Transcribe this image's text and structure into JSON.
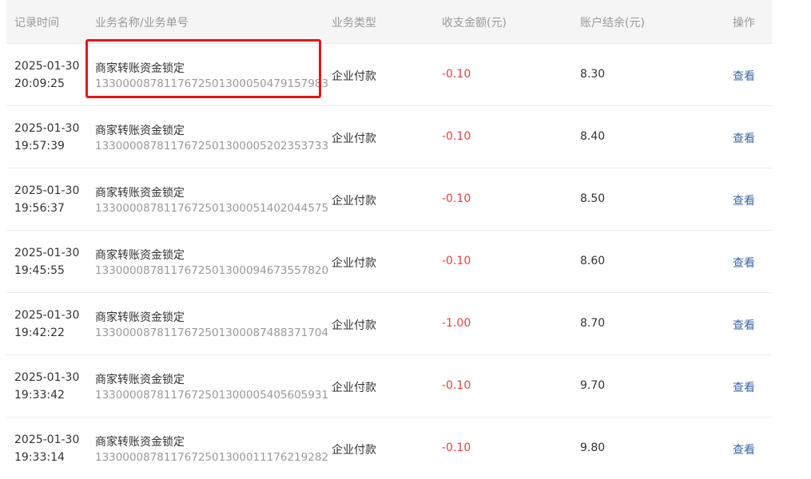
{
  "headers": {
    "time": "记录时间",
    "name": "业务名称/业务单号",
    "type": "业务类型",
    "amount": "收支金额(元)",
    "balance": "账户结余(元)",
    "action": "操作"
  },
  "rows": [
    {
      "date": "2025-01-30",
      "time": "20:09:25",
      "name": "商家转账资金锁定",
      "order": "1330000878117672501300050479157983",
      "type": "企业付款",
      "amount": "-0.10",
      "balance": "8.30",
      "action": "查看"
    },
    {
      "date": "2025-01-30",
      "time": "19:57:39",
      "name": "商家转账资金锁定",
      "order": "1330000878117672501300005202353733",
      "type": "企业付款",
      "amount": "-0.10",
      "balance": "8.40",
      "action": "查看"
    },
    {
      "date": "2025-01-30",
      "time": "19:56:37",
      "name": "商家转账资金锁定",
      "order": "1330000878117672501300051402044575",
      "type": "企业付款",
      "amount": "-0.10",
      "balance": "8.50",
      "action": "查看"
    },
    {
      "date": "2025-01-30",
      "time": "19:45:55",
      "name": "商家转账资金锁定",
      "order": "1330000878117672501300094673557820",
      "type": "企业付款",
      "amount": "-0.10",
      "balance": "8.60",
      "action": "查看"
    },
    {
      "date": "2025-01-30",
      "time": "19:42:22",
      "name": "商家转账资金锁定",
      "order": "1330000878117672501300087488371704",
      "type": "企业付款",
      "amount": "-1.00",
      "balance": "8.70",
      "action": "查看"
    },
    {
      "date": "2025-01-30",
      "time": "19:33:42",
      "name": "商家转账资金锁定",
      "order": "1330000878117672501300005405605931",
      "type": "企业付款",
      "amount": "-0.10",
      "balance": "9.70",
      "action": "查看"
    },
    {
      "date": "2025-01-30",
      "time": "19:33:14",
      "name": "商家转账资金锁定",
      "order": "1330000878117672501300011176219282",
      "type": "企业付款",
      "amount": "-0.10",
      "balance": "9.80",
      "action": "查看"
    }
  ],
  "colors": {
    "amount_negative": "#e8413b",
    "link": "#3a66a8",
    "highlight": "#e6151b"
  }
}
